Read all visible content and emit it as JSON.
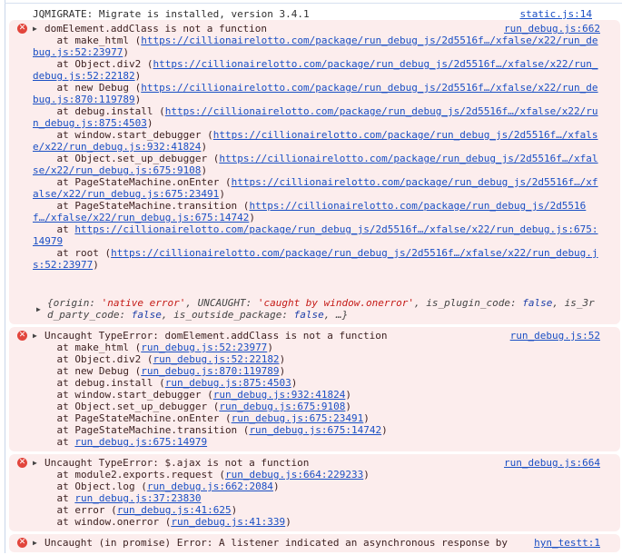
{
  "info": {
    "text": "JQMIGRATE: Migrate is installed, version 3.4.1",
    "source": "static.js:14"
  },
  "messages": [
    {
      "icon": "error-icon",
      "message": "domElement.addClass is not a function",
      "source": "run_debug.js:662",
      "stack": [
        {
          "fn": "make_html",
          "url": "https://cillionairelotto.com/package/run_debug_js/2d5516f…/xfalse/x22/run_debug.js:52:23977"
        },
        {
          "fn": "Object.div2",
          "url": "https://cillionairelotto.com/package/run_debug_js/2d5516f…/xfalse/x22/run_debug.js:52:22182"
        },
        {
          "fn": "new Debug",
          "url": "https://cillionairelotto.com/package/run_debug_js/2d5516f…/xfalse/x22/run_debug.js:870:119789"
        },
        {
          "fn": "debug.install",
          "url": "https://cillionairelotto.com/package/run_debug_js/2d5516f…/xfalse/x22/run_debug.js:875:4503"
        },
        {
          "fn": "window.start_debugger",
          "url": "https://cillionairelotto.com/package/run_debug_js/2d5516f…/xfalse/x22/run_debug.js:932:41824"
        },
        {
          "fn": "Object.set_up_debugger",
          "url": "https://cillionairelotto.com/package/run_debug_js/2d5516f…/xfalse/x22/run_debug.js:675:9108"
        },
        {
          "fn": "PageStateMachine.onEnter",
          "url": "https://cillionairelotto.com/package/run_debug_js/2d5516f…/xfalse/x22/run_debug.js:675:23491"
        },
        {
          "fn": "PageStateMachine.transition",
          "url": "https://cillionairelotto.com/package/run_debug_js/2d5516f…/xfalse/x22/run_debug.js:675:14742"
        },
        {
          "fn": "",
          "url": "https://cillionairelotto.com/package/run_debug_js/2d5516f…/xfalse/x22/run_debug.js:675:14979"
        },
        {
          "fn": "root",
          "url": "https://cillionairelotto.com/package/run_debug_js/2d5516f…/xfalse/x22/run_debug.js:52:23977"
        }
      ],
      "object": [
        {
          "key": "origin",
          "value": "'native error'",
          "type": "str"
        },
        {
          "key": "UNCAUGHT",
          "value": "'caught by window.onerror'",
          "type": "str"
        },
        {
          "key": "is_plugin_code",
          "value": "false",
          "type": "bool"
        },
        {
          "key": "is_3rd_party_code",
          "value": "false",
          "type": "bool"
        },
        {
          "key": "is_outside_package",
          "value": "false",
          "type": "bool"
        }
      ]
    },
    {
      "icon": "error-icon",
      "message": "Uncaught TypeError: domElement.addClass is not a function",
      "source": "run_debug.js:52",
      "stack": [
        {
          "fn": "make_html",
          "url": "run_debug.js:52:23977"
        },
        {
          "fn": "Object.div2",
          "url": "run_debug.js:52:22182"
        },
        {
          "fn": "new Debug",
          "url": "run_debug.js:870:119789"
        },
        {
          "fn": "debug.install",
          "url": "run_debug.js:875:4503"
        },
        {
          "fn": "window.start_debugger",
          "url": "run_debug.js:932:41824"
        },
        {
          "fn": "Object.set_up_debugger",
          "url": "run_debug.js:675:9108"
        },
        {
          "fn": "PageStateMachine.onEnter",
          "url": "run_debug.js:675:23491"
        },
        {
          "fn": "PageStateMachine.transition",
          "url": "run_debug.js:675:14742"
        },
        {
          "fn": "",
          "url": "run_debug.js:675:14979"
        }
      ]
    },
    {
      "icon": "error-icon",
      "message": "Uncaught TypeError: $.ajax is not a function",
      "source": "run_debug.js:664",
      "stack": [
        {
          "fn": "module2.exports.request",
          "url": "run_debug.js:664:229233"
        },
        {
          "fn": "Object.log",
          "url": "run_debug.js:662:2084"
        },
        {
          "fn": "",
          "url": "run_debug.js:37:23830"
        },
        {
          "fn": "error",
          "url": "run_debug.js:41:625"
        },
        {
          "fn": "window.onerror",
          "url": "run_debug.js:41:339"
        }
      ]
    },
    {
      "icon": "error-icon",
      "message": "Uncaught (in promise) Error: A listener indicated an asynchronous response by",
      "source": "hyn_testt:1",
      "stack": []
    }
  ]
}
